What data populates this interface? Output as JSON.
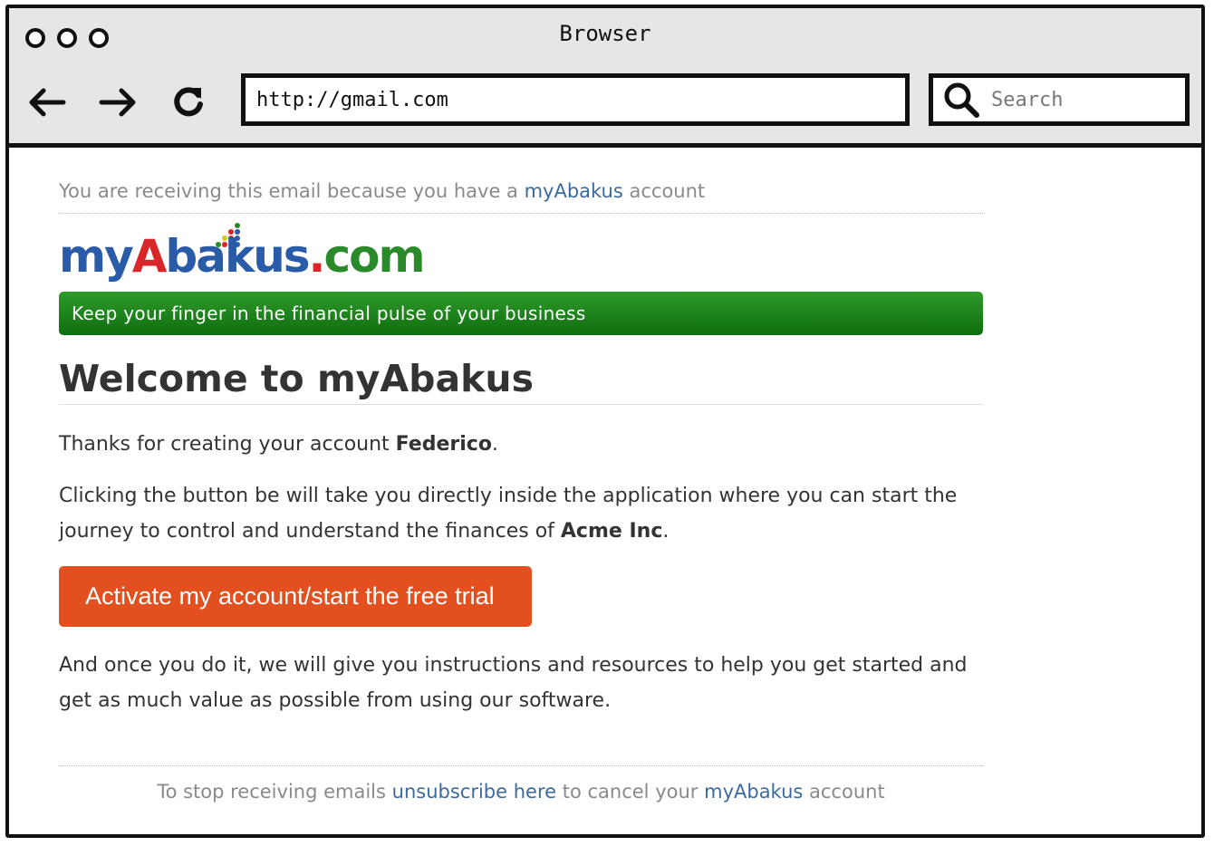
{
  "browser": {
    "title": "Browser",
    "url": "http://gmail.com",
    "search_placeholder": "Search"
  },
  "email": {
    "notice": {
      "prefix": "You are receiving this email because you have a",
      "link": "myAbakus",
      "suffix": "account"
    },
    "logo": {
      "my": "my",
      "a": "A",
      "bakus": "bakus",
      "dot": ".",
      "com": "com"
    },
    "tagline": "Keep your finger in the financial pulse of your business",
    "heading": "Welcome to myAbakus",
    "thanks": {
      "prefix": "Thanks for creating your account",
      "name": "Federico",
      "suffix": "."
    },
    "intro": {
      "text": "Clicking the button be will take you directly inside the application where you can start the journey to control and understand the finances of",
      "company": "Acme Inc",
      "suffix": "."
    },
    "cta_label": "Activate my account/start the free trial",
    "followup": "And once you do it, we will give you instructions and resources to help you get started and get as much value as possible from using our software.",
    "footer": {
      "prefix": "To stop receiving emails",
      "unsubscribe": "unsubscribe here",
      "middle": "to cancel your",
      "link": "myAbakus",
      "suffix": "account"
    }
  },
  "colors": {
    "link": "#3b6aa0",
    "banner": "#1f8a1f",
    "cta": "#e2501f"
  }
}
